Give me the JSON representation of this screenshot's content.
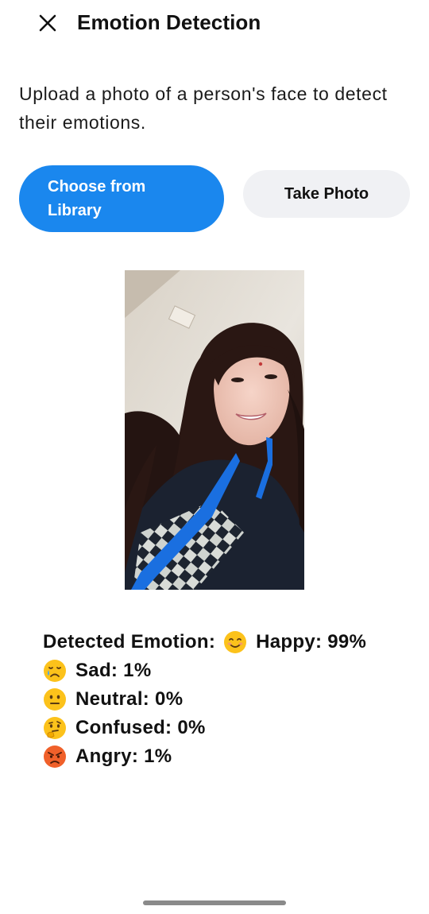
{
  "header": {
    "title": "Emotion Detection",
    "close_icon": "close-icon"
  },
  "description": "Upload a photo of a person's face to detect their emotions.",
  "buttons": {
    "library_label": "Choose from Library",
    "camera_label": "Take Photo"
  },
  "colors": {
    "primary": "#1a87ee",
    "secondary_button": "#f0f1f4"
  },
  "results": {
    "detected_label": "Detected Emotion:",
    "emotions": [
      {
        "icon": "smiling-face-emoji",
        "text": "Happy: 99%",
        "value": 99
      },
      {
        "icon": "crying-face-emoji",
        "text": "Sad: 1%",
        "value": 1
      },
      {
        "icon": "neutral-face-emoji",
        "text": "Neutral: 0%",
        "value": 0
      },
      {
        "icon": "thinking-face-emoji",
        "text": "Confused: 0%",
        "value": 0
      },
      {
        "icon": "angry-face-emoji",
        "text": "Angry: 1%",
        "value": 1
      }
    ]
  }
}
